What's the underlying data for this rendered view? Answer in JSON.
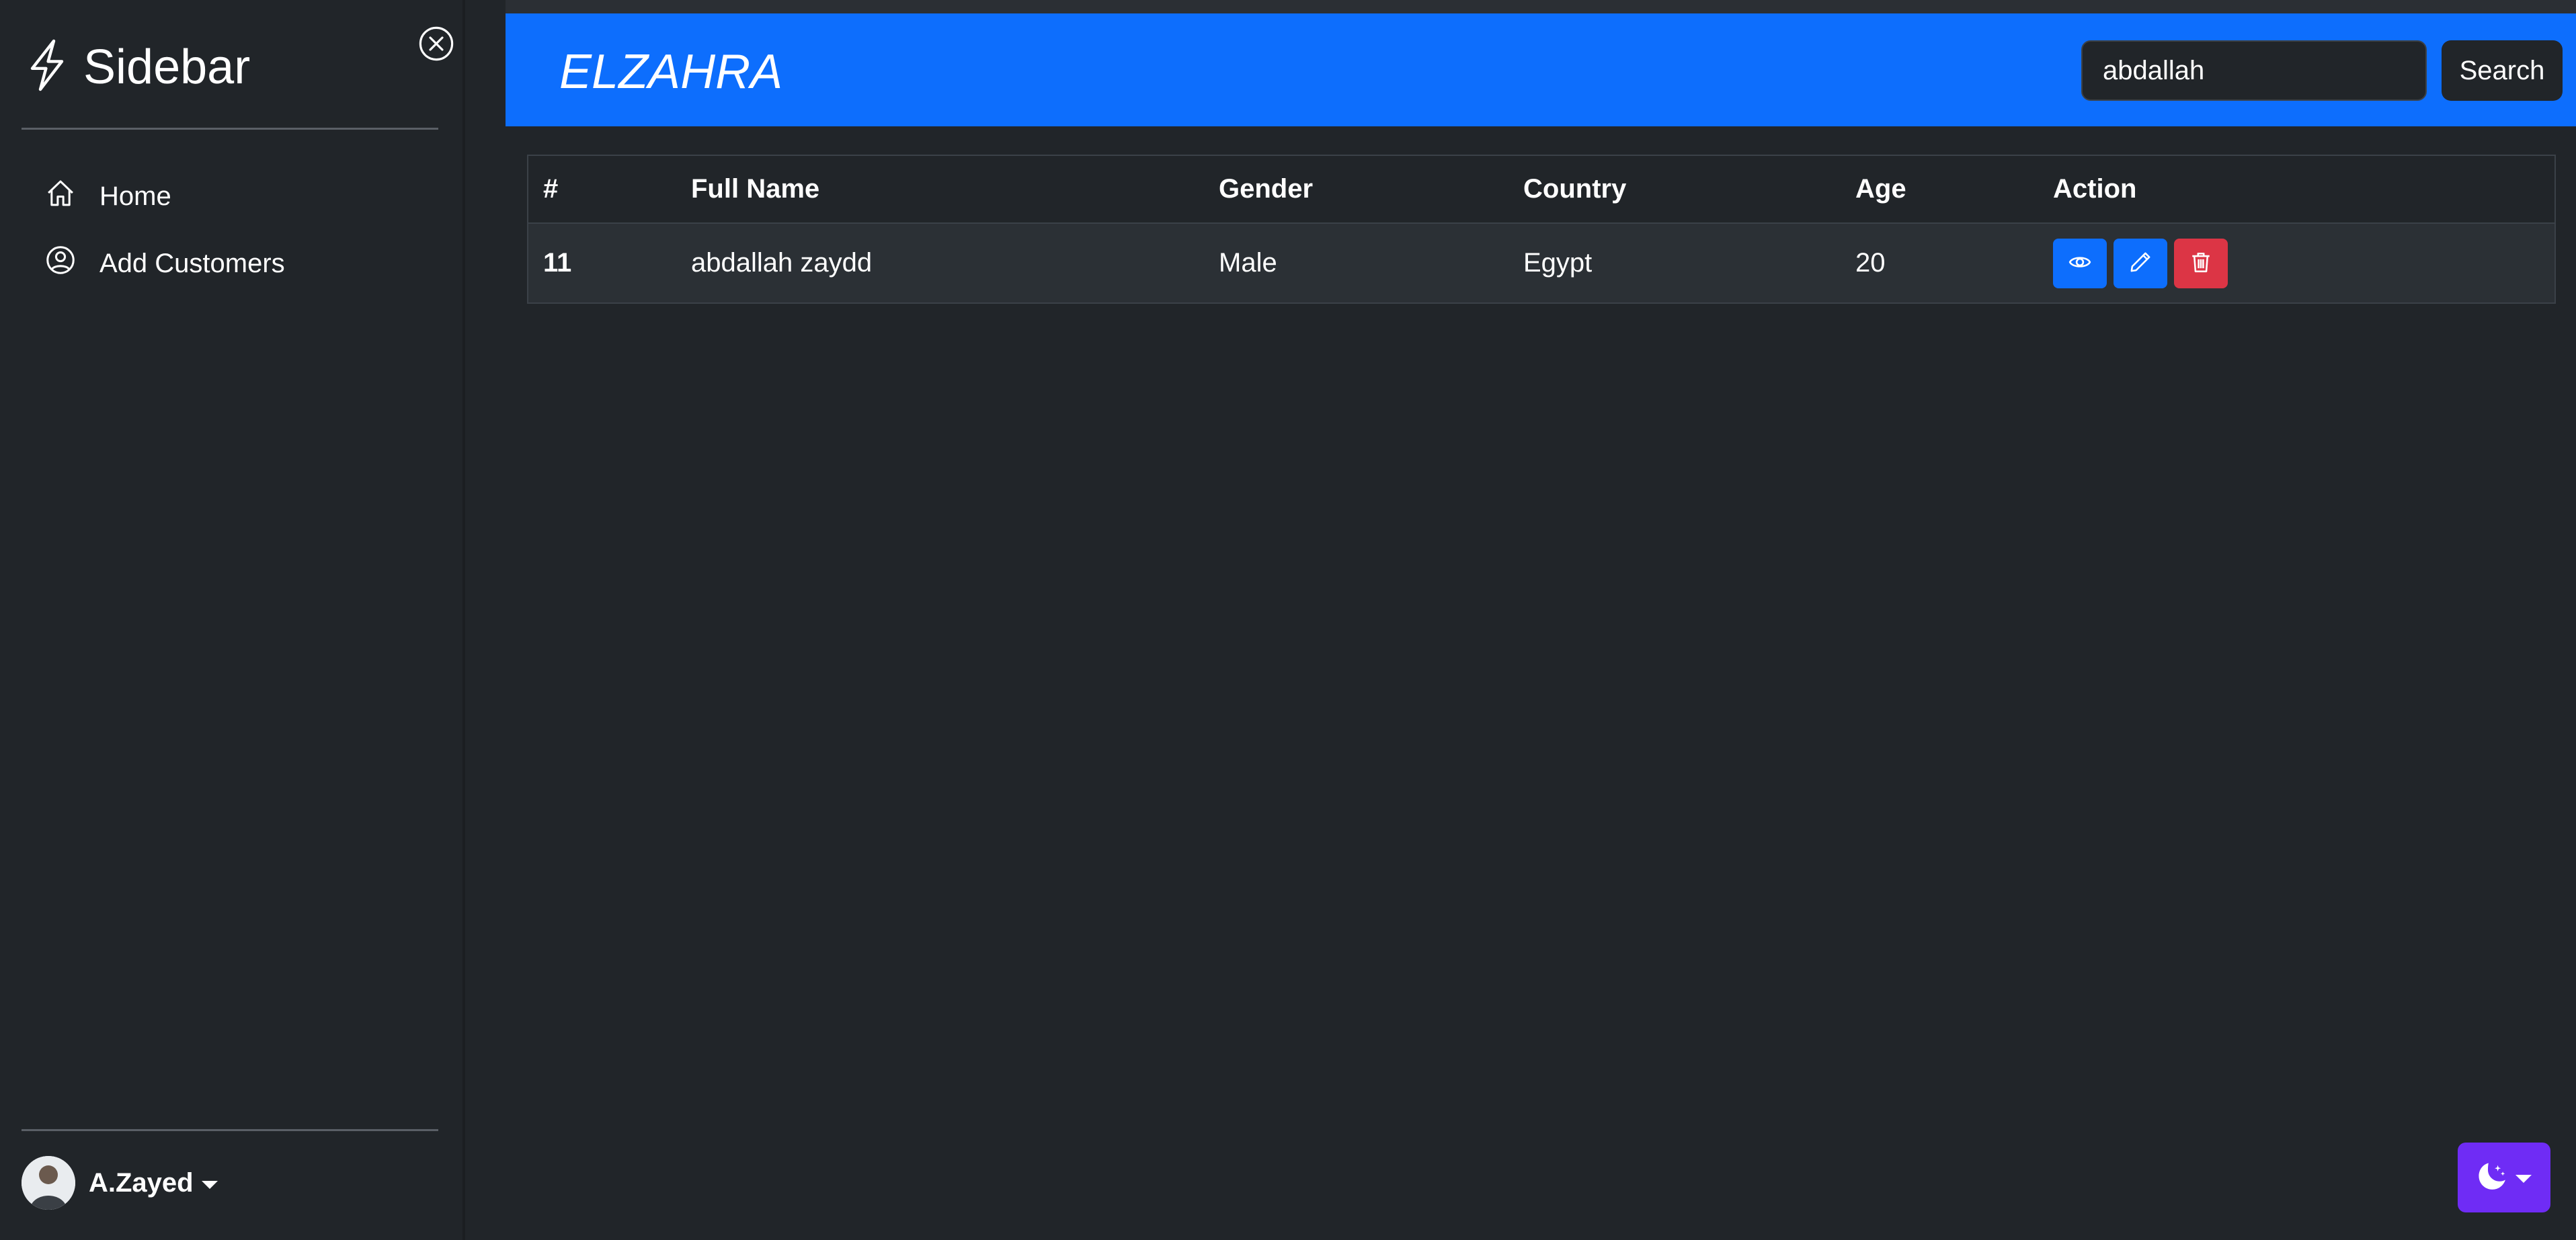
{
  "sidebar": {
    "title": "Sidebar",
    "items": [
      {
        "label": "Home",
        "icon": "house-icon"
      },
      {
        "label": "Add Customers",
        "icon": "person-circle-icon"
      }
    ],
    "user": {
      "name": "A.Zayed"
    }
  },
  "navbar": {
    "brand": "ELZAHRA",
    "search": {
      "value": "abdallah",
      "button_label": "Search"
    }
  },
  "table": {
    "headers": [
      "#",
      "Full Name",
      "Gender",
      "Country",
      "Age",
      "Action"
    ],
    "rows": [
      {
        "id": "11",
        "full_name": "abdallah zaydd",
        "gender": "Male",
        "country": "Egypt",
        "age": "20"
      }
    ]
  },
  "colors": {
    "primary": "#0d6efd",
    "danger": "#dc3545",
    "theme_toggle": "#6f2cf5",
    "background": "#212529"
  }
}
